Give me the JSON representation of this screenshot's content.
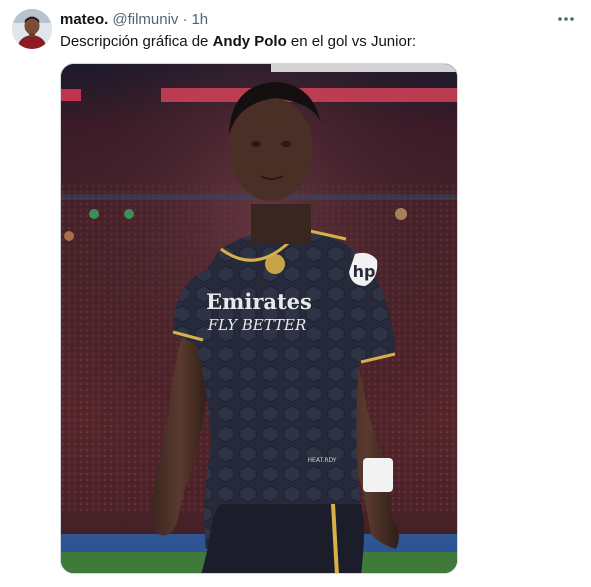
{
  "author": {
    "display_name": "mateo.",
    "handle": "@filmuniv",
    "separator": "·",
    "timestamp": "1h"
  },
  "tweet": {
    "text_before": "Descripción gráfica de ",
    "text_bold": "Andy Polo",
    "text_after": " en el gol vs Junior:"
  },
  "media": {
    "jersey_sponsor_line1": "Emirates",
    "jersey_sponsor_line2": "FLY BETTER",
    "jersey_sleeve_logo": "hp",
    "jersey_hem_text": "HEAT.RDY"
  },
  "icons": {
    "more": "more-horizontal-icon",
    "avatar": "profile-avatar"
  },
  "colors": {
    "text_primary": "#0f1419",
    "text_secondary": "#536471",
    "border": "#cfd9de"
  }
}
